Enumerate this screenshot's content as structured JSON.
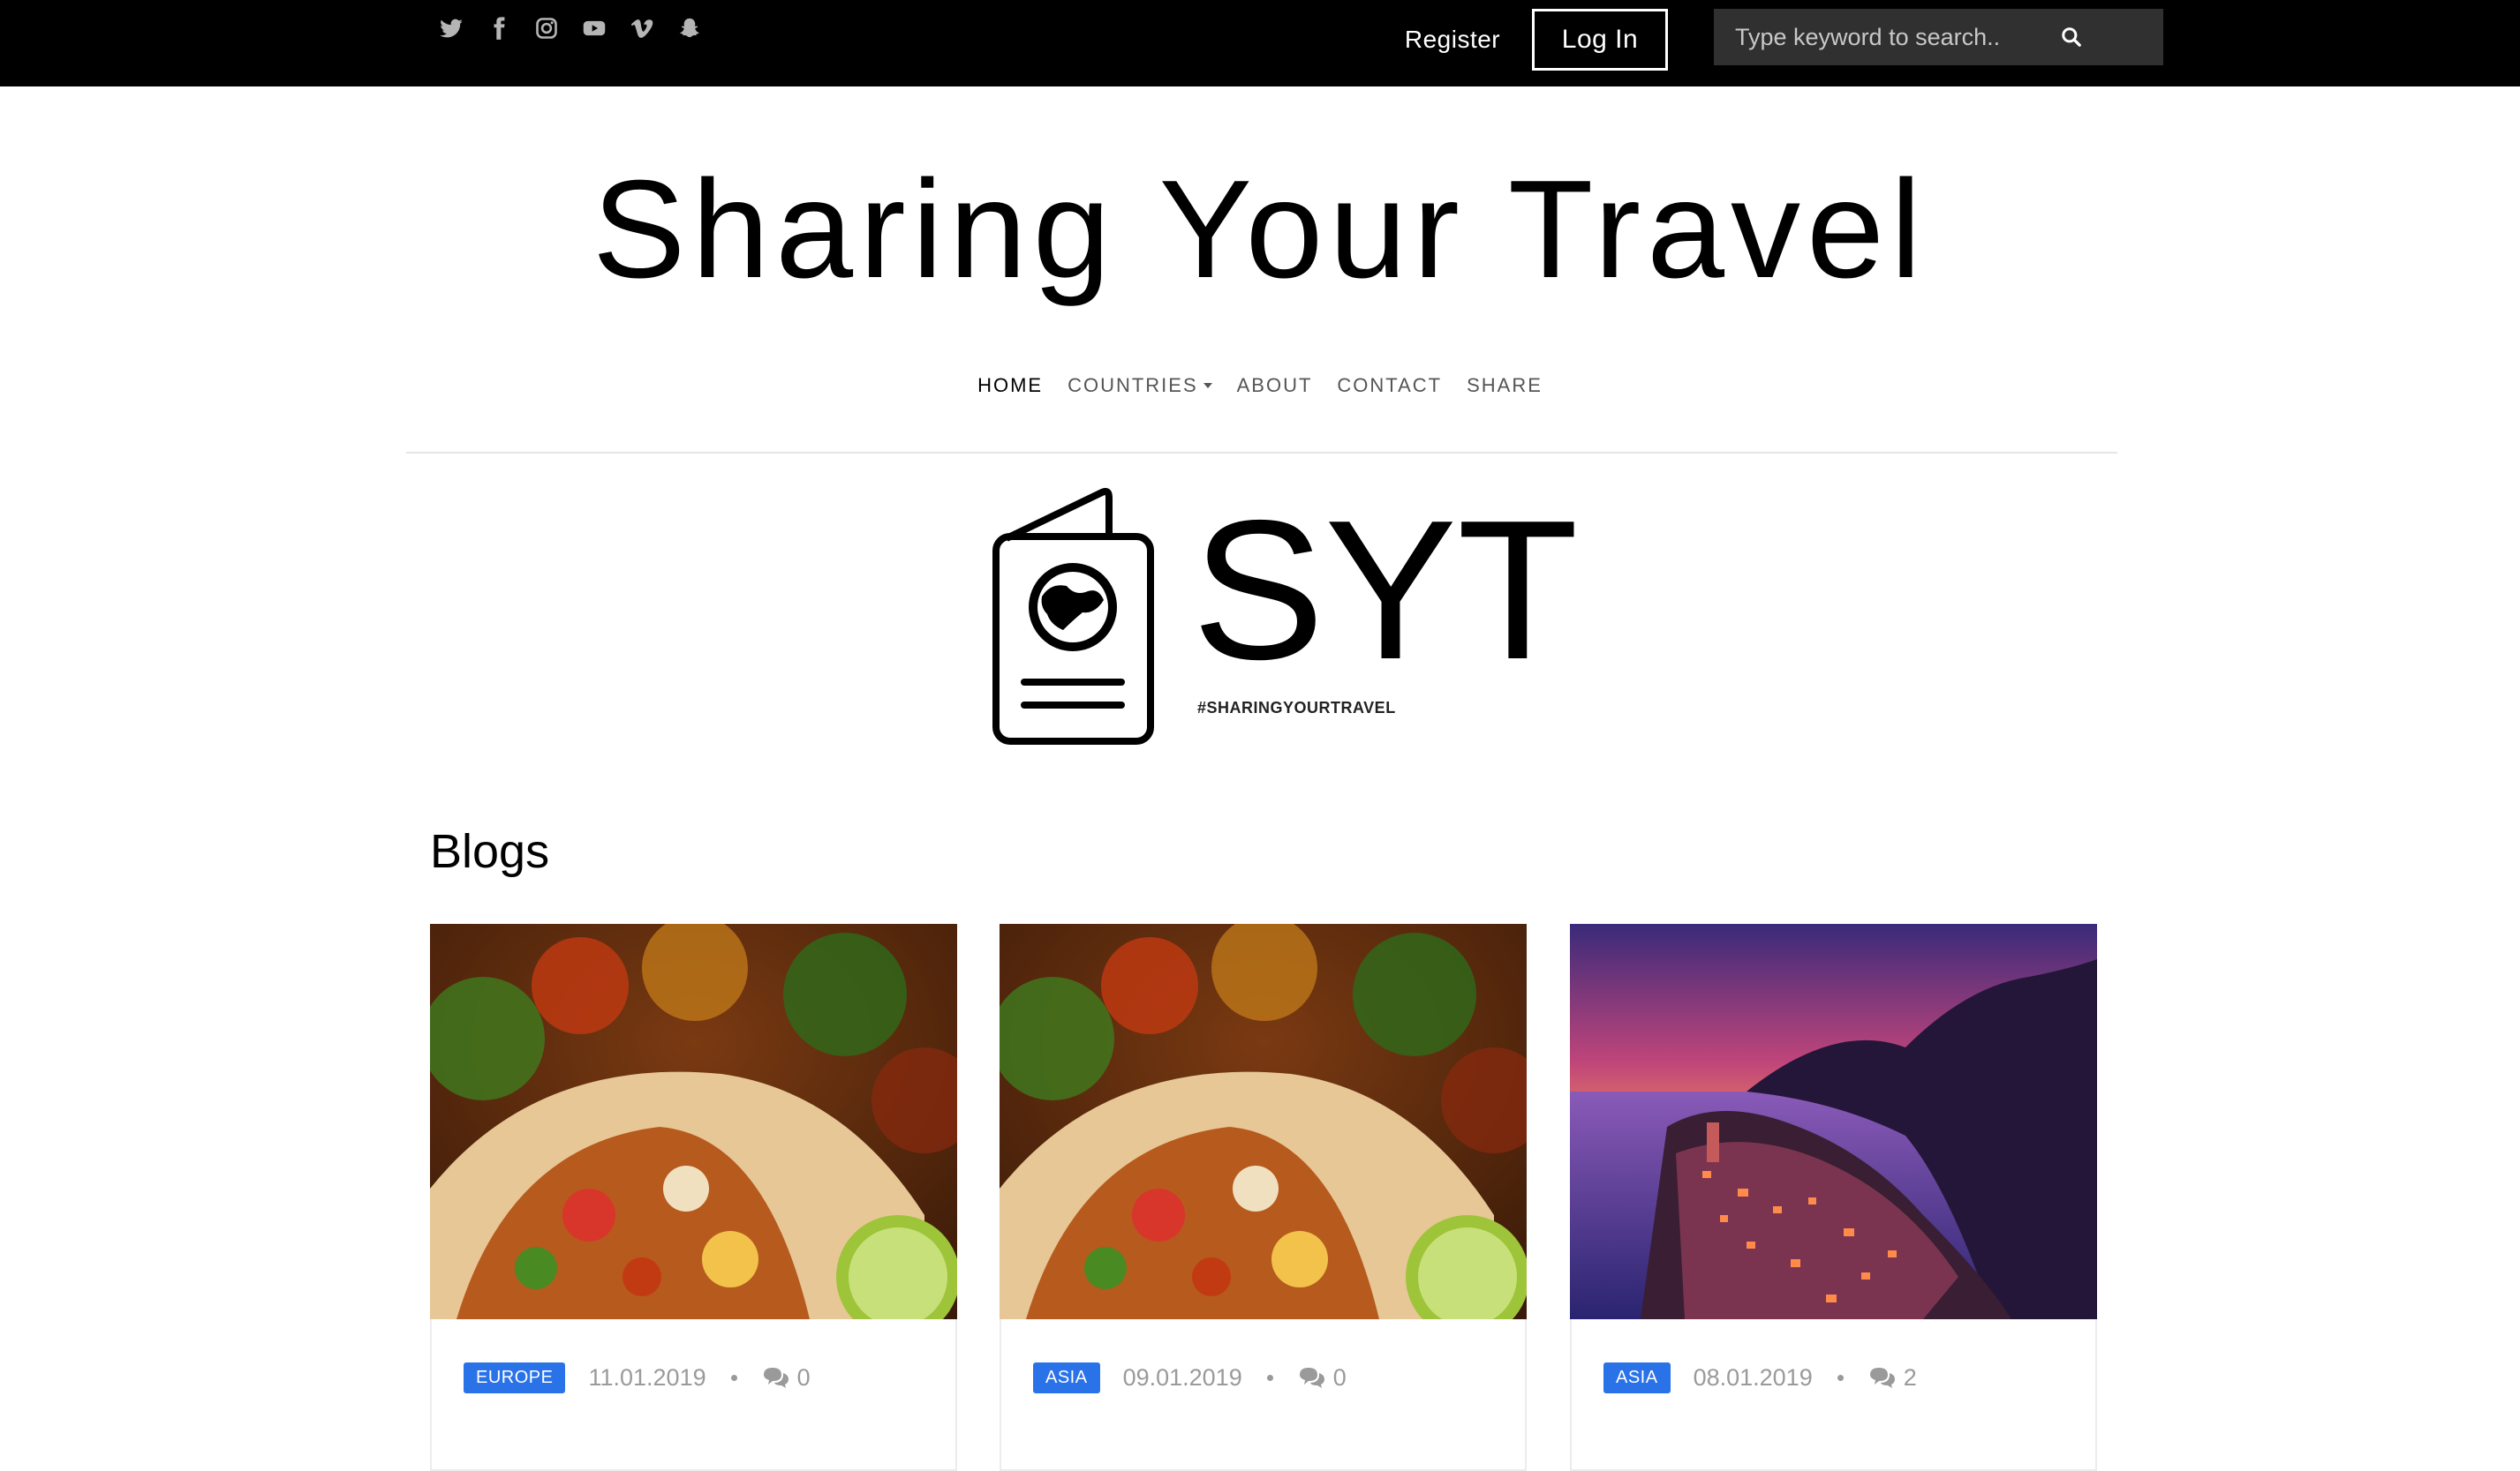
{
  "topbar": {
    "socials": [
      {
        "icon": "twitter-icon"
      },
      {
        "icon": "facebook-icon"
      },
      {
        "icon": "instagram-icon"
      },
      {
        "icon": "youtube-icon"
      },
      {
        "icon": "vimeo-icon"
      },
      {
        "icon": "snapchat-icon"
      }
    ],
    "register_label": "Register",
    "login_label": "Log In",
    "search_placeholder": "Type keyword to search..",
    "search_icon": "search-icon"
  },
  "header": {
    "site_title": "Sharing Your Travel",
    "nav": [
      {
        "label": "HOME",
        "active": true
      },
      {
        "label": "COUNTRIES",
        "dropdown": true
      },
      {
        "label": "ABOUT"
      },
      {
        "label": "CONTACT"
      },
      {
        "label": "SHARE"
      }
    ]
  },
  "logo": {
    "icon": "passport-globe-icon",
    "text": "SYT",
    "tagline": "#SHARINGYOURTRAVEL"
  },
  "blogs": {
    "heading": "Blogs",
    "cards": [
      {
        "image": "burrito-photo",
        "category": "EUROPE",
        "date": "11.01.2019",
        "comments": "0"
      },
      {
        "image": "burrito-photo",
        "category": "ASIA",
        "date": "09.01.2019",
        "comments": "0"
      },
      {
        "image": "coastal-village-sunset-photo",
        "category": "ASIA",
        "date": "08.01.2019",
        "comments": "2"
      }
    ]
  },
  "colors": {
    "topbar_bg": "#000000",
    "search_bg": "#303030",
    "badge_bg": "#2a72e8",
    "meta_text": "#9a9a9a"
  }
}
